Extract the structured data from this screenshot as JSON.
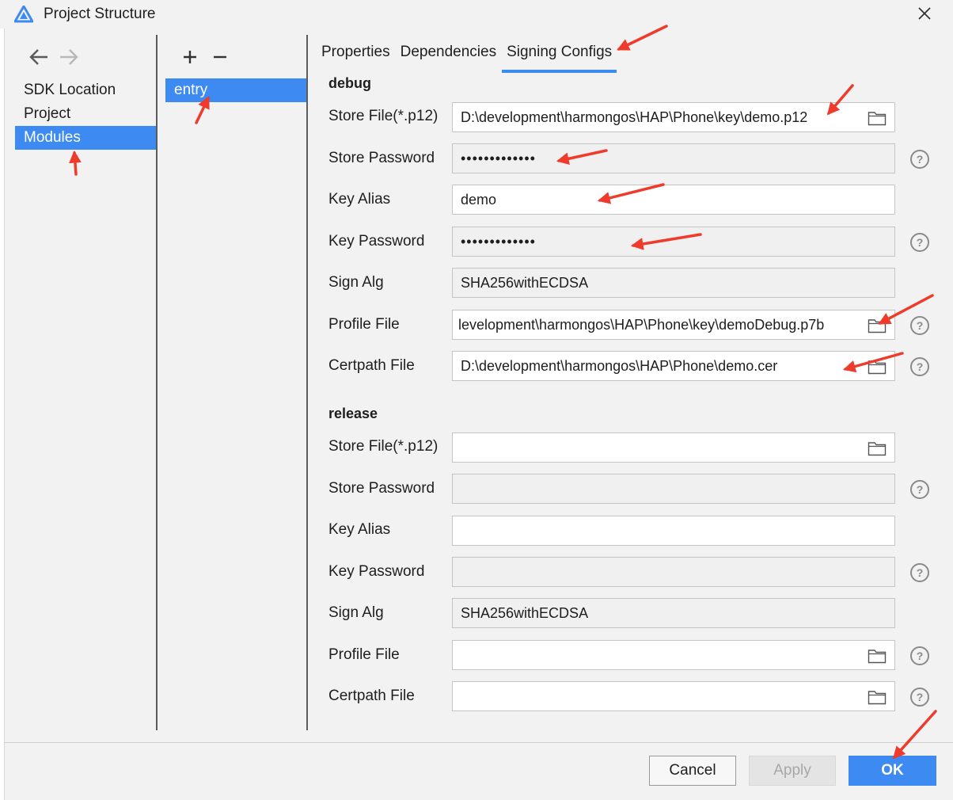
{
  "window": {
    "title": "Project Structure",
    "app_icon": "triangle-logo-icon",
    "close_icon": "close-icon"
  },
  "nav": {
    "back_icon": "arrow-left-icon",
    "forward_icon": "arrow-right-icon",
    "items": [
      {
        "label": "SDK Location",
        "selected": false
      },
      {
        "label": "Project",
        "selected": false
      },
      {
        "label": "Modules",
        "selected": true
      }
    ]
  },
  "modules": {
    "add_symbol": "+",
    "remove_symbol": "−",
    "items": [
      {
        "label": "entry",
        "selected": true
      }
    ]
  },
  "tabs": [
    {
      "label": "Properties",
      "active": false
    },
    {
      "label": "Dependencies",
      "active": false
    },
    {
      "label": "Signing Configs",
      "active": true
    }
  ],
  "debug": {
    "title": "debug",
    "store_file_label": "Store File(*.p12)",
    "store_file_value": "D:\\development\\harmongos\\HAP\\Phone\\key\\demo.p12",
    "store_password_label": "Store Password",
    "store_password_value": "•••••••••••••",
    "key_alias_label": "Key Alias",
    "key_alias_value": "demo",
    "key_password_label": "Key Password",
    "key_password_value": "•••••••••••••",
    "sign_alg_label": "Sign Alg",
    "sign_alg_value": "SHA256withECDSA",
    "profile_file_label": "Profile File",
    "profile_file_value": "levelopment\\harmongos\\HAP\\Phone\\key\\demoDebug.p7b",
    "certpath_file_label": "Certpath File",
    "certpath_file_value": "D:\\development\\harmongos\\HAP\\Phone\\demo.cer"
  },
  "release": {
    "title": "release",
    "store_file_label": "Store File(*.p12)",
    "store_file_value": "",
    "store_password_label": "Store Password",
    "store_password_value": "",
    "key_alias_label": "Key Alias",
    "key_alias_value": "",
    "key_password_label": "Key Password",
    "key_password_value": "",
    "sign_alg_label": "Sign Alg",
    "sign_alg_value": "SHA256withECDSA",
    "profile_file_label": "Profile File",
    "profile_file_value": "",
    "certpath_file_label": "Certpath File",
    "certpath_file_value": ""
  },
  "icons": {
    "folder": "folder-icon",
    "help": "help-icon"
  },
  "footer": {
    "cancel_label": "Cancel",
    "apply_label": "Apply",
    "ok_label": "OK",
    "apply_enabled": false
  },
  "colors": {
    "accent": "#3d8bf2",
    "annotation_arrow": "#ee3b2c",
    "disabled_text": "#a7a7a7"
  }
}
